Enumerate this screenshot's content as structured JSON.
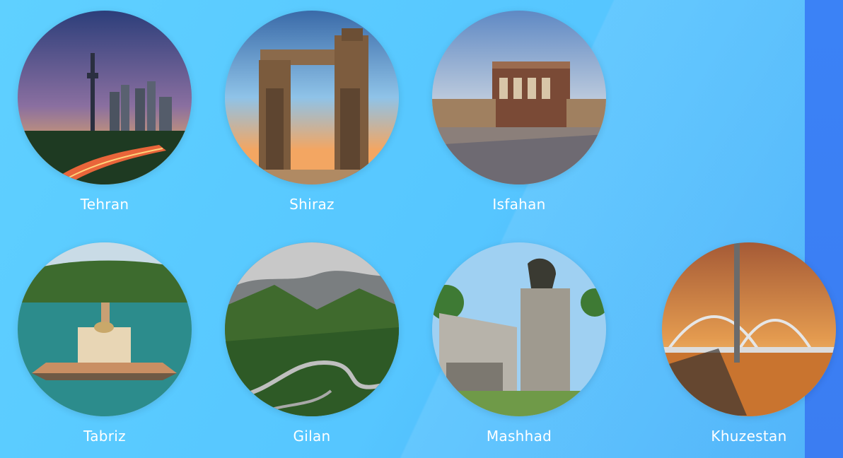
{
  "cities": [
    {
      "label": "Tehran",
      "image": "tehran-milad-tower-night-traffic"
    },
    {
      "label": "Shiraz",
      "image": "shiraz-persepolis-gate"
    },
    {
      "label": "Isfahan",
      "image": "isfahan-ali-qapu-palace"
    },
    {
      "label": "Tabriz",
      "image": "tabriz-el-goli-pavilion"
    },
    {
      "label": "Gilan",
      "image": "gilan-mountain-winding-road"
    },
    {
      "label": "Mashhad",
      "image": "mashhad-nader-shah-monument"
    },
    {
      "label": "Khuzestan",
      "image": "khuzestan-white-bridge-sunset"
    }
  ],
  "colors": {
    "bg_left": "#5fd0ff",
    "bg_right": "#43a7f6",
    "strip": "#3b82f6",
    "text": "#ffffff"
  }
}
